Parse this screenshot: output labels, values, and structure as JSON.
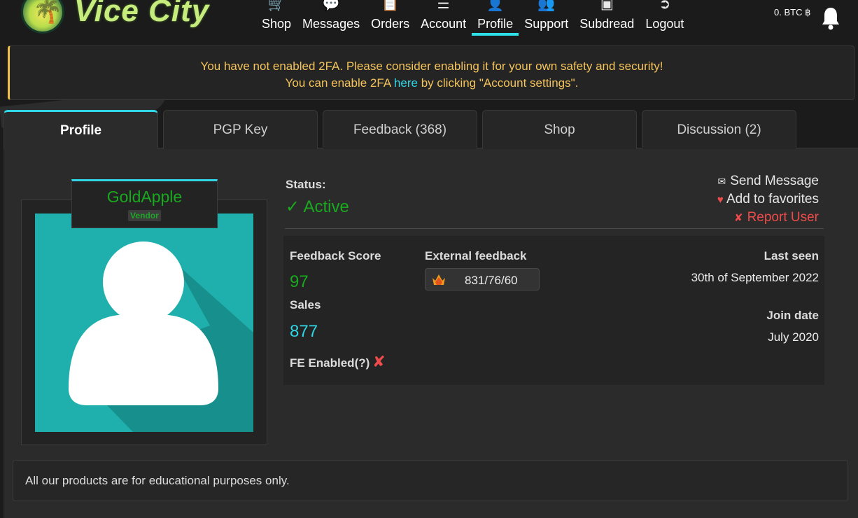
{
  "brand": {
    "name": "Vice City"
  },
  "nav": {
    "items": [
      {
        "label": "Shop",
        "icon": "cart-icon"
      },
      {
        "label": "Messages",
        "icon": "chat-icon"
      },
      {
        "label": "Orders",
        "icon": "orders-icon"
      },
      {
        "label": "Account",
        "icon": "menu-icon"
      },
      {
        "label": "Profile",
        "icon": "user-icon",
        "active": true
      },
      {
        "label": "Support",
        "icon": "users-icon"
      },
      {
        "label": "Subdread",
        "icon": "board-icon"
      },
      {
        "label": "Logout",
        "icon": "logout-icon"
      }
    ],
    "balance": "0. BTC ฿"
  },
  "alert": {
    "line1": "You have not enabled 2FA. Please consider enabling it for your own safety and security!",
    "line2_pre": "You can enable 2FA ",
    "line2_link": "here",
    "line2_post": " by clicking \"Account settings\".",
    "accent_color": "#f1c24a"
  },
  "tabs": [
    {
      "label": "Profile",
      "active": true
    },
    {
      "label": "PGP Key"
    },
    {
      "label": "Feedback (368)"
    },
    {
      "label": "Shop"
    },
    {
      "label": "Discussion (2)"
    }
  ],
  "profile": {
    "username": "GoldApple",
    "role": "Vendor",
    "status_label": "Status:",
    "status_value": "✓ Active",
    "actions": {
      "send_message": "Send Message",
      "add_favorite": "Add to favorites",
      "report_user": "Report User"
    },
    "stats": {
      "feedback_score_label": "Feedback Score",
      "feedback_score": "97",
      "sales_label": "Sales",
      "sales": "877",
      "fe_label": "FE Enabled(?)",
      "fe_enabled": false,
      "external_label": "External feedback",
      "external_value": "831/76/60",
      "last_seen_label": "Last seen",
      "last_seen": "30th of September 2022",
      "join_label": "Join date",
      "join_date": "July 2020"
    }
  },
  "footer": {
    "note": "All our products are for educational purposes only."
  },
  "colors": {
    "accent": "#2fd6e6",
    "success": "#19a91f",
    "danger": "#ef4b4b",
    "warning": "#f4c35b"
  }
}
